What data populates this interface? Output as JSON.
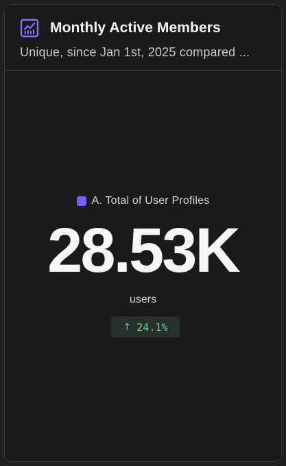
{
  "card": {
    "title": "Monthly Active Members",
    "subtitle": "Unique, since Jan 1st, 2025 compared ...",
    "icon": "line-chart-icon"
  },
  "metric": {
    "series_label": "A. Total of User Profiles",
    "series_color": "#7c5cff",
    "value": "28.53K",
    "unit": "users",
    "change": "24.1%",
    "change_direction": "up",
    "change_color": "#5fd68a"
  }
}
